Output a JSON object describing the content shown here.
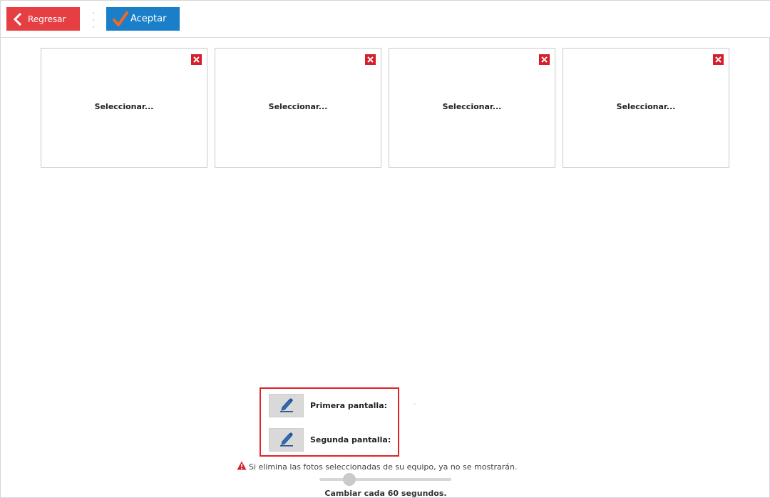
{
  "toolbar": {
    "back_label": "Regresar",
    "accept_label": "Aceptar",
    "back_color": "#e63f43",
    "accept_color": "#1a7fc8",
    "check_color": "#f26a21"
  },
  "slots": [
    {
      "label": "Seleccionar..."
    },
    {
      "label": "Seleccionar..."
    },
    {
      "label": "Seleccionar..."
    },
    {
      "label": "Seleccionar..."
    }
  ],
  "screens": {
    "first_label": "Primera pantalla:",
    "second_label": "Segunda pantalla:",
    "highlight_color": "#e12228"
  },
  "warning": {
    "text": "Si elimina las fotos seleccionadas de su equipo, ya no se mostrarán.",
    "icon": "warning-triangle-icon"
  },
  "interval": {
    "text": "Cambiar cada 60 segundos.",
    "seconds": 60
  }
}
